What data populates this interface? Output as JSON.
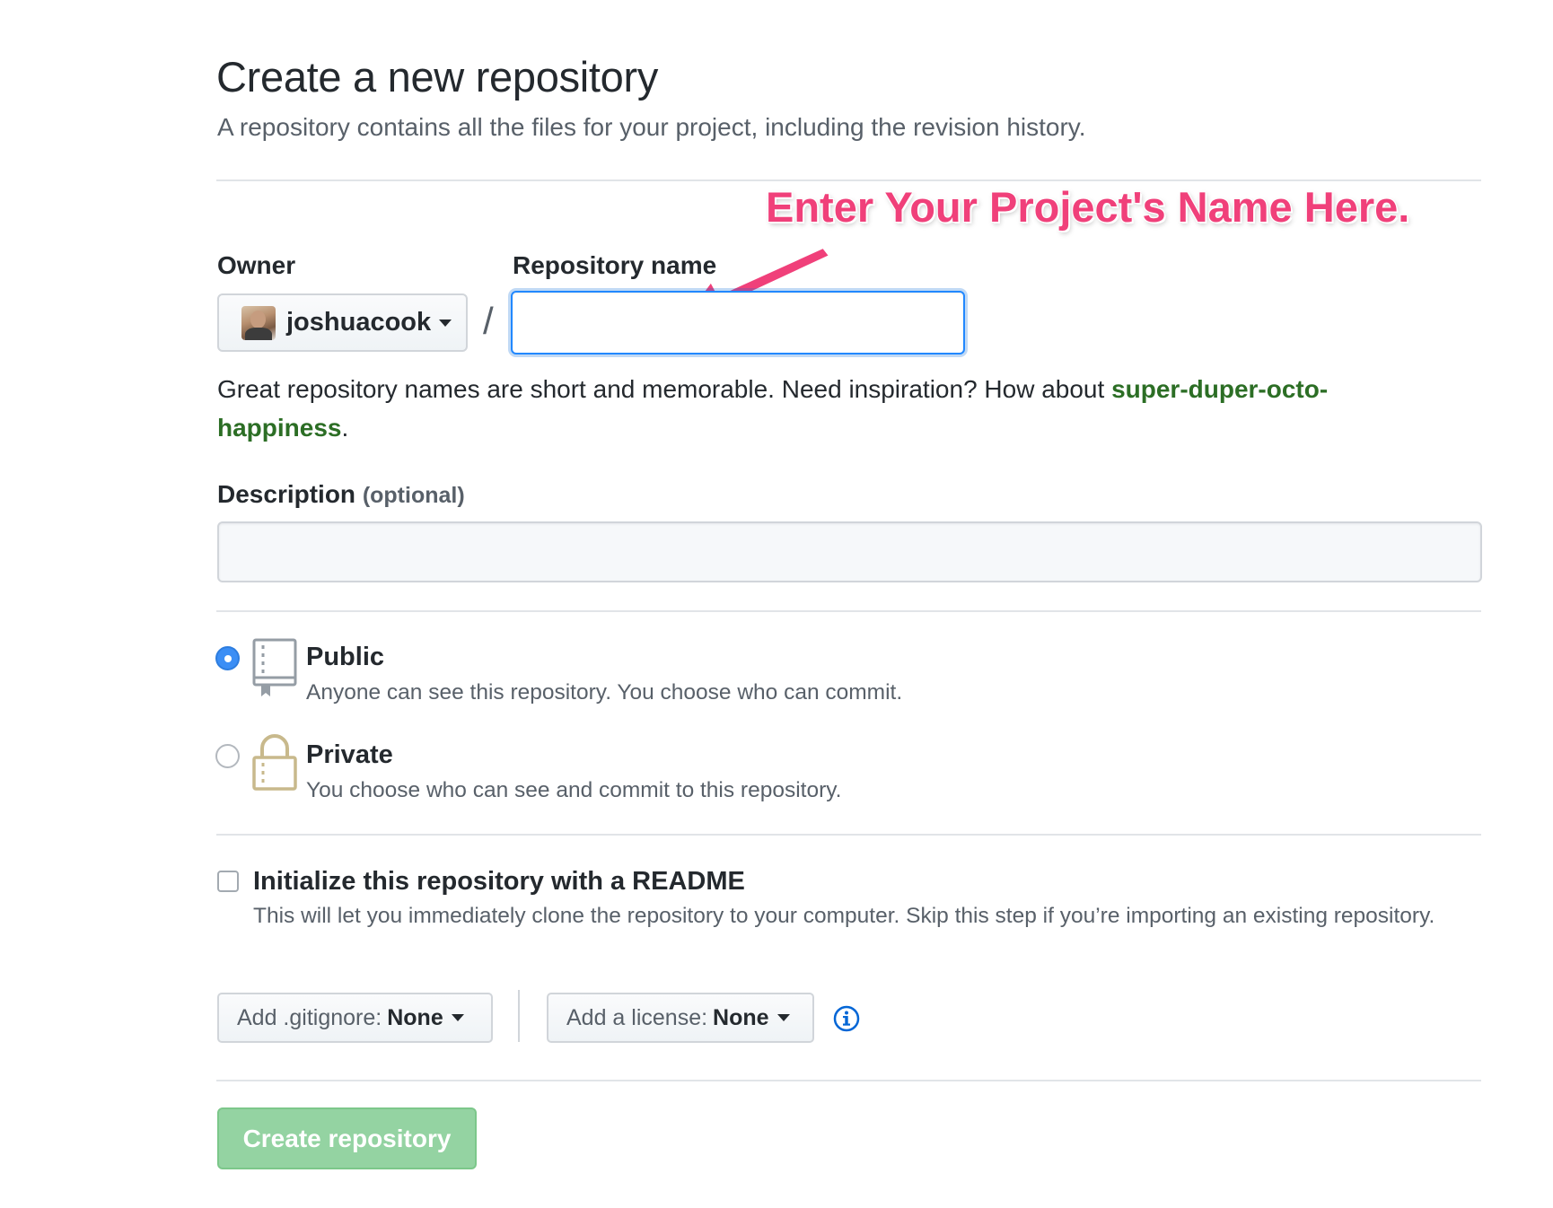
{
  "header": {
    "title": "Create a new repository",
    "subtitle": "A repository contains all the files for your project, including the revision history."
  },
  "annotation": {
    "text": "Enter Your Project's Name Here.",
    "color": "#f0407a"
  },
  "owner": {
    "label": "Owner",
    "value": "joshuacook"
  },
  "separator": "/",
  "repo_name": {
    "label": "Repository name",
    "value": ""
  },
  "hint": {
    "text": "Great repository names are short and memorable. Need inspiration? How about ",
    "suggestion": "super-duper-octo-happiness",
    "end": "."
  },
  "description": {
    "label": "Description",
    "optional": "(optional)",
    "value": ""
  },
  "visibility": {
    "selected": "public",
    "public": {
      "title": "Public",
      "desc": "Anyone can see this repository. You choose who can commit.",
      "icon": "repo-icon"
    },
    "private": {
      "title": "Private",
      "desc": "You choose who can see and commit to this repository.",
      "icon": "lock-icon"
    }
  },
  "readme": {
    "checked": false,
    "title": "Initialize this repository with a README",
    "desc": "This will let you immediately clone the repository to your computer. Skip this step if you’re importing an existing repository."
  },
  "gitignore": {
    "label": "Add .gitignore:",
    "value": "None"
  },
  "license": {
    "label": "Add a license:",
    "value": "None"
  },
  "info_icon": "info-icon",
  "submit": {
    "label": "Create repository",
    "color": "#94d3a2"
  }
}
